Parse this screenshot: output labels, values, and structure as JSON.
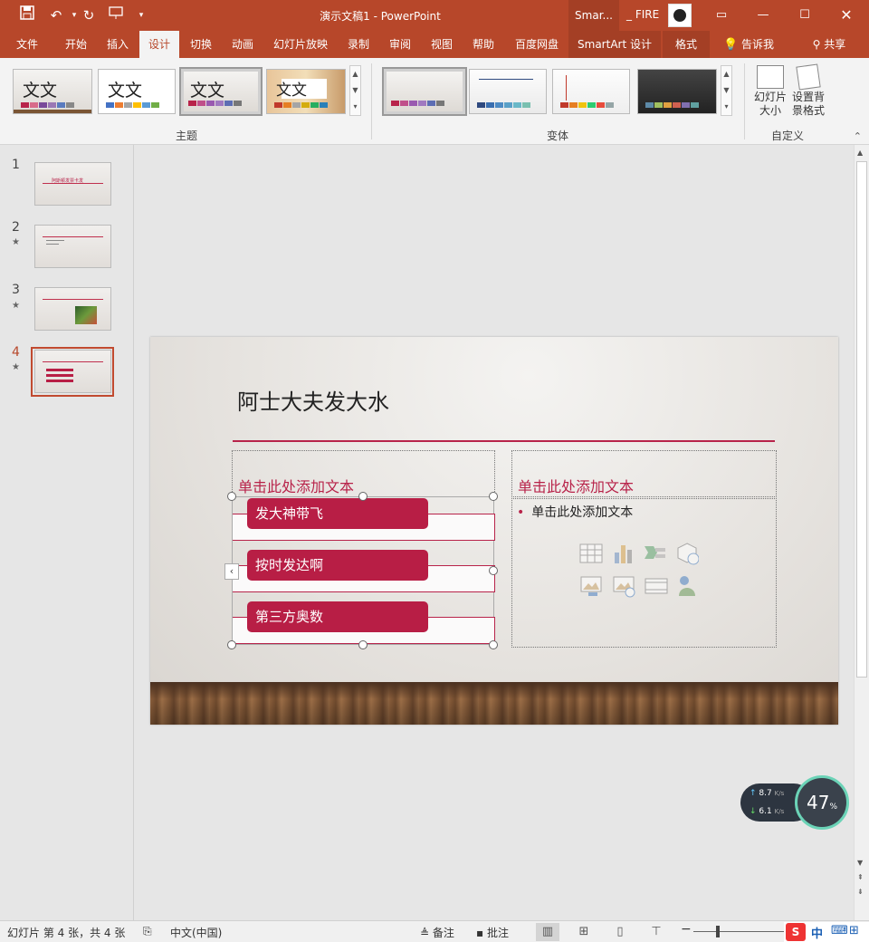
{
  "titlebar": {
    "title": "演示文稿1  -  PowerPoint",
    "context_group": "Smar...",
    "user": "_ FIRE",
    "quick_access": [
      "save-icon",
      "undo-icon",
      "redo-icon",
      "slideshow-icon",
      "customize-icon"
    ]
  },
  "tabs": [
    "文件",
    "开始",
    "插入",
    "设计",
    "切换",
    "动画",
    "幻灯片放映",
    "录制",
    "审阅",
    "视图",
    "帮助",
    "百度网盘",
    "SmartArt 设计",
    "格式"
  ],
  "active_tab": "设计",
  "tell_me": "告诉我",
  "share": "共享",
  "ribbon": {
    "themes_label": "主题",
    "variants_label": "变体",
    "customize_label": "自定义",
    "theme_sample_text": "文文",
    "slide_size": "幻灯片\n大小",
    "format_bg": "设置背\n景格式",
    "themes": [
      {
        "swatches": [
          "#b8234a",
          "#d86b8a",
          "#7a4a9a",
          "#9b78b5",
          "#5a7bbf",
          "#888"
        ]
      },
      {
        "swatches": [
          "#4472c4",
          "#ed7d31",
          "#a5a5a5",
          "#ffc000",
          "#5b9bd5",
          "#70ad47"
        ]
      },
      {
        "swatches": [
          "#b8234a",
          "#c0508a",
          "#9a5ab0",
          "#a079c0",
          "#5d6db3",
          "#777"
        ]
      },
      {
        "swatches": [
          "#c0392b",
          "#e67e22",
          "#a5a5a5",
          "#d4ac0d",
          "#27ae60",
          "#2980b9"
        ]
      }
    ],
    "variants": [
      {
        "swatches": [
          "#b8234a",
          "#c0508a",
          "#9a5ab0",
          "#a079c0",
          "#5d6db3",
          "#777"
        ]
      },
      {
        "swatches": [
          "#2f4a7f",
          "#3a6fb0",
          "#4e8bc4",
          "#5aa0c8",
          "#6ab8c8",
          "#7ac0b0"
        ]
      },
      {
        "swatches": [
          "#c0392b",
          "#e67e22",
          "#f1c40f",
          "#2ecc71",
          "#e74c3c",
          "#95a5a6"
        ]
      },
      {
        "swatches": [
          "#5d8aa8",
          "#a0c060",
          "#e0a040",
          "#d06050",
          "#8070b0",
          "#60a0a0"
        ]
      }
    ]
  },
  "slides": [
    {
      "num": "1",
      "title_text": "阿斯顿发票卡发"
    },
    {
      "num": "2"
    },
    {
      "num": "3"
    },
    {
      "num": "4"
    }
  ],
  "current_slide": {
    "title": "阿士大夫发大水",
    "left_header": "单击此处添加文本",
    "right_header": "单击此处添加文本",
    "bullet": "单击此处添加文本",
    "smartart_items": [
      "发大神带飞",
      "按时发达啊",
      "第三方奥数"
    ]
  },
  "network_widget": {
    "up": "8.7",
    "down": "6.1",
    "unit": "K/s",
    "cpu": "47"
  },
  "status": {
    "slide_info": "幻灯片 第 4 张，共 4 张",
    "language": "中文(中国)",
    "notes": "备注",
    "comments": "批注"
  },
  "ime": {
    "label": "中"
  }
}
